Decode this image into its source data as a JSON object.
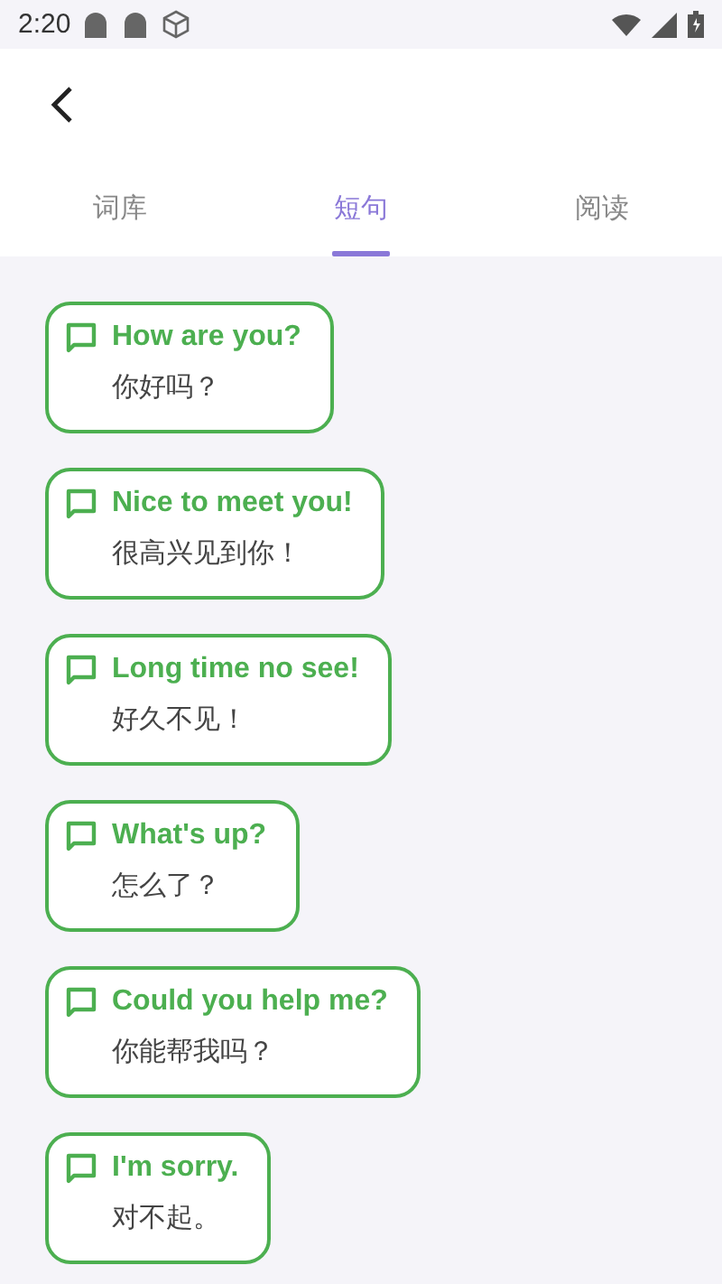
{
  "status_bar": {
    "time": "2:20"
  },
  "tabs": [
    {
      "label": "词库",
      "selected": false
    },
    {
      "label": "短句",
      "selected": true
    },
    {
      "label": "阅读",
      "selected": false
    }
  ],
  "phrases": [
    {
      "english": "How are you?",
      "chinese": "你好吗？"
    },
    {
      "english": "Nice to meet you!",
      "chinese": "很高兴见到你！"
    },
    {
      "english": "Long time no see!",
      "chinese": "好久不见！"
    },
    {
      "english": "What's up?",
      "chinese": "怎么了？"
    },
    {
      "english": "Could you help me?",
      "chinese": "你能帮我吗？"
    },
    {
      "english": "I'm sorry.",
      "chinese": "对不起。"
    }
  ]
}
